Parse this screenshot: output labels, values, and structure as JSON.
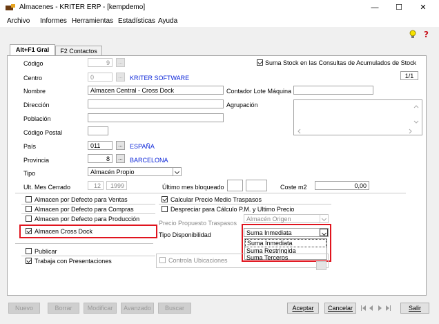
{
  "window": {
    "title": "Almacenes - KRITER ERP - [kempdemo]",
    "minimize": "—",
    "maximize": "☐",
    "close": "✕"
  },
  "menu": [
    "Archivo",
    "Informes",
    "Herramientas",
    "Estadísticas",
    "Ayuda"
  ],
  "tabs": [
    "Alt+F1 Gral",
    "F2 Contactos"
  ],
  "form": {
    "codigo_label": "Código",
    "codigo_value": "9",
    "centro_label": "Centro",
    "centro_value": "0",
    "centro_name": "KRITER SOFTWARE",
    "suma_stock_label": "Suma Stock en las Consultas de Acumulados de Stock",
    "suma_stock_checked": true,
    "pager": "1/1",
    "nombre_label": "Nombre",
    "nombre_value": "Almacen Central - Cross Dock",
    "contador_label": "Contador Lote Máquina",
    "contador_value": "",
    "direccion_label": "Dirección",
    "direccion_value": "",
    "agrupacion_label": "Agrupación",
    "poblacion_label": "Población",
    "poblacion_value": "",
    "cp_label": "Código Postal",
    "cp_value": "",
    "pais_label": "País",
    "pais_value": "011",
    "pais_name": "ESPAÑA",
    "provincia_label": "Provincia",
    "provincia_value": "8",
    "provincia_name": "BARCELONA",
    "tipo_label": "Tipo",
    "tipo_value": "Almacén Propio",
    "ult_mes_label": "Ult. Mes Cerrado",
    "ult_mes_month": "12",
    "ult_mes_year": "1999",
    "ultimo_bloq_label": "Último mes bloqueado",
    "coste_label": "Coste m2",
    "coste_value": "0,00"
  },
  "checks_left": [
    {
      "label": "Almacen por Defecto para Ventas",
      "checked": false
    },
    {
      "label": "Almacen por Defecto para Compras",
      "checked": false
    },
    {
      "label": "Almacen por Defecto para Producción",
      "checked": false
    },
    {
      "label": "Almacen Cross Dock",
      "checked": true
    }
  ],
  "checks_right": [
    {
      "label": "Calcular Precio Medio Traspasos",
      "checked": true
    },
    {
      "label": "Despreciar para Cálculo P.M. y Ultimo Precio",
      "checked": false
    }
  ],
  "precio_traspasos_label": "Precio Propuesto Traspasos",
  "precio_traspasos_value": "Almacén Origen",
  "tipo_disp_label": "Tipo Disponibilidad",
  "tipo_disp_value": "Suma Inmediata",
  "tipo_disp_options": [
    "Suma Inmediata",
    "Suma Restringida",
    "Suma Terceros"
  ],
  "publicar_label": "Publicar",
  "publicar_checked": false,
  "trabaja_label": "Trabaja con Presentaciones",
  "trabaja_checked": true,
  "controla_label": "Controla Ubicaciones",
  "controla_checked": false,
  "buttons": {
    "nuevo": "Nuevo",
    "borrar": "Borrar",
    "modificar": "Modificar",
    "avanzado": "Avanzado",
    "buscar": "Buscar",
    "aceptar": "Aceptar",
    "cancelar": "Cancelar",
    "salir": "Salir"
  },
  "colors": {
    "highlight_red": "#e0141e",
    "link_blue": "#0a24d8"
  }
}
